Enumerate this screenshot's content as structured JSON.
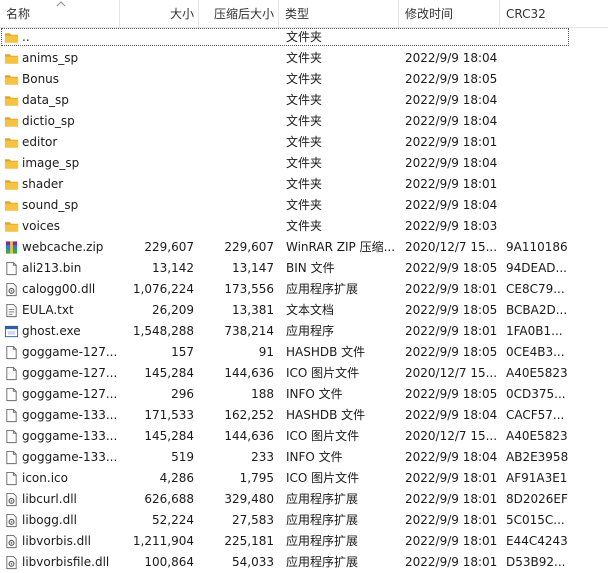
{
  "columns": {
    "name": "名称",
    "size": "大小",
    "compressed": "压缩后大小",
    "type": "类型",
    "modified": "修改时间",
    "crc": "CRC32"
  },
  "rows": [
    {
      "name": "..",
      "size": "",
      "compressed": "",
      "type": "文件夹",
      "modified": "",
      "crc": "",
      "icon": "folder-icon"
    },
    {
      "name": "anims_sp",
      "size": "",
      "compressed": "",
      "type": "文件夹",
      "modified": "2022/9/9 18:04",
      "crc": "",
      "icon": "folder-icon"
    },
    {
      "name": "Bonus",
      "size": "",
      "compressed": "",
      "type": "文件夹",
      "modified": "2022/9/9 18:05",
      "crc": "",
      "icon": "folder-icon"
    },
    {
      "name": "data_sp",
      "size": "",
      "compressed": "",
      "type": "文件夹",
      "modified": "2022/9/9 18:04",
      "crc": "",
      "icon": "folder-icon"
    },
    {
      "name": "dictio_sp",
      "size": "",
      "compressed": "",
      "type": "文件夹",
      "modified": "2022/9/9 18:04",
      "crc": "",
      "icon": "folder-icon"
    },
    {
      "name": "editor",
      "size": "",
      "compressed": "",
      "type": "文件夹",
      "modified": "2022/9/9 18:01",
      "crc": "",
      "icon": "folder-icon"
    },
    {
      "name": "image_sp",
      "size": "",
      "compressed": "",
      "type": "文件夹",
      "modified": "2022/9/9 18:04",
      "crc": "",
      "icon": "folder-icon"
    },
    {
      "name": "shader",
      "size": "",
      "compressed": "",
      "type": "文件夹",
      "modified": "2022/9/9 18:01",
      "crc": "",
      "icon": "folder-icon"
    },
    {
      "name": "sound_sp",
      "size": "",
      "compressed": "",
      "type": "文件夹",
      "modified": "2022/9/9 18:04",
      "crc": "",
      "icon": "folder-icon"
    },
    {
      "name": "voices",
      "size": "",
      "compressed": "",
      "type": "文件夹",
      "modified": "2022/9/9 18:03",
      "crc": "",
      "icon": "folder-icon"
    },
    {
      "name": "webcache.zip",
      "size": "229,607",
      "compressed": "229,607",
      "type": "WinRAR ZIP 压缩...",
      "modified": "2020/12/7 15...",
      "crc": "9A110186",
      "icon": "winrar-icon"
    },
    {
      "name": "ali213.bin",
      "size": "13,142",
      "compressed": "13,147",
      "type": "BIN 文件",
      "modified": "2022/9/9 18:05",
      "crc": "94DEAD...",
      "icon": "file-icon"
    },
    {
      "name": "calogg00.dll",
      "size": "1,076,224",
      "compressed": "173,556",
      "type": "应用程序扩展",
      "modified": "2022/9/9 18:01",
      "crc": "CE8C79...",
      "icon": "dll-icon"
    },
    {
      "name": "EULA.txt",
      "size": "26,209",
      "compressed": "13,381",
      "type": "文本文档",
      "modified": "2022/9/9 18:05",
      "crc": "BCBA2D...",
      "icon": "text-file-icon"
    },
    {
      "name": "ghost.exe",
      "size": "1,548,288",
      "compressed": "738,214",
      "type": "应用程序",
      "modified": "2022/9/9 18:01",
      "crc": "1FA0B1...",
      "icon": "exe-icon"
    },
    {
      "name": "goggame-127...",
      "size": "157",
      "compressed": "91",
      "type": "HASHDB 文件",
      "modified": "2022/9/9 18:05",
      "crc": "0CE4B3...",
      "icon": "file-icon"
    },
    {
      "name": "goggame-127...",
      "size": "145,284",
      "compressed": "144,636",
      "type": "ICO 图片文件",
      "modified": "2020/12/7 15...",
      "crc": "A40E5823",
      "icon": "file-icon"
    },
    {
      "name": "goggame-127...",
      "size": "296",
      "compressed": "188",
      "type": "INFO 文件",
      "modified": "2022/9/9 18:05",
      "crc": "0CD375...",
      "icon": "file-icon"
    },
    {
      "name": "goggame-133...",
      "size": "171,533",
      "compressed": "162,252",
      "type": "HASHDB 文件",
      "modified": "2022/9/9 18:04",
      "crc": "CACF57...",
      "icon": "file-icon"
    },
    {
      "name": "goggame-133...",
      "size": "145,284",
      "compressed": "144,636",
      "type": "ICO 图片文件",
      "modified": "2020/12/7 15...",
      "crc": "A40E5823",
      "icon": "file-icon"
    },
    {
      "name": "goggame-133...",
      "size": "519",
      "compressed": "233",
      "type": "INFO 文件",
      "modified": "2022/9/9 18:04",
      "crc": "AB2E3958",
      "icon": "file-icon"
    },
    {
      "name": "icon.ico",
      "size": "4,286",
      "compressed": "1,795",
      "type": "ICO 图片文件",
      "modified": "2022/9/9 18:01",
      "crc": "AF91A3E1",
      "icon": "file-icon"
    },
    {
      "name": "libcurl.dll",
      "size": "626,688",
      "compressed": "329,480",
      "type": "应用程序扩展",
      "modified": "2022/9/9 18:01",
      "crc": "8D2026EF",
      "icon": "dll-icon"
    },
    {
      "name": "libogg.dll",
      "size": "52,224",
      "compressed": "27,583",
      "type": "应用程序扩展",
      "modified": "2022/9/9 18:01",
      "crc": "5C015C...",
      "icon": "dll-icon"
    },
    {
      "name": "libvorbis.dll",
      "size": "1,211,904",
      "compressed": "225,181",
      "type": "应用程序扩展",
      "modified": "2022/9/9 18:01",
      "crc": "E44C4243",
      "icon": "dll-icon"
    },
    {
      "name": "libvorbisfile.dll",
      "size": "100,864",
      "compressed": "54,033",
      "type": "应用程序扩展",
      "modified": "2022/9/9 18:01",
      "crc": "D53B92...",
      "icon": "dll-icon"
    }
  ],
  "colors": {
    "folder": "#f5c242",
    "folder_dark": "#e0a526",
    "header_border": "#e5e5e5"
  }
}
